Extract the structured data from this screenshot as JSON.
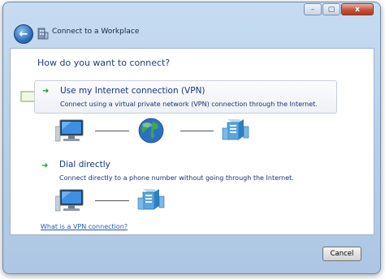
{
  "window": {
    "title": "Connect to a Workplace",
    "controls": {
      "minimize": "–",
      "maximize": "▢",
      "close": "x"
    }
  },
  "main": {
    "heading": "How do you want to connect?",
    "options": [
      {
        "title": "Use my Internet connection (VPN)",
        "description": "Connect using a virtual private network (VPN) connection through the Internet.",
        "diagram": [
          "computer-icon",
          "globe-icon",
          "server-icon"
        ]
      },
      {
        "title": "Dial directly",
        "description": "Connect directly to a phone number without going through the Internet.",
        "diagram": [
          "computer-icon",
          "server-icon"
        ]
      }
    ],
    "help_link": "What is a VPN connection?"
  },
  "footer": {
    "cancel_label": "Cancel"
  },
  "colors": {
    "heading": "#1d3d80",
    "option_title": "#17357a",
    "arrow": "#1e9a2f",
    "link": "#2457b8"
  }
}
